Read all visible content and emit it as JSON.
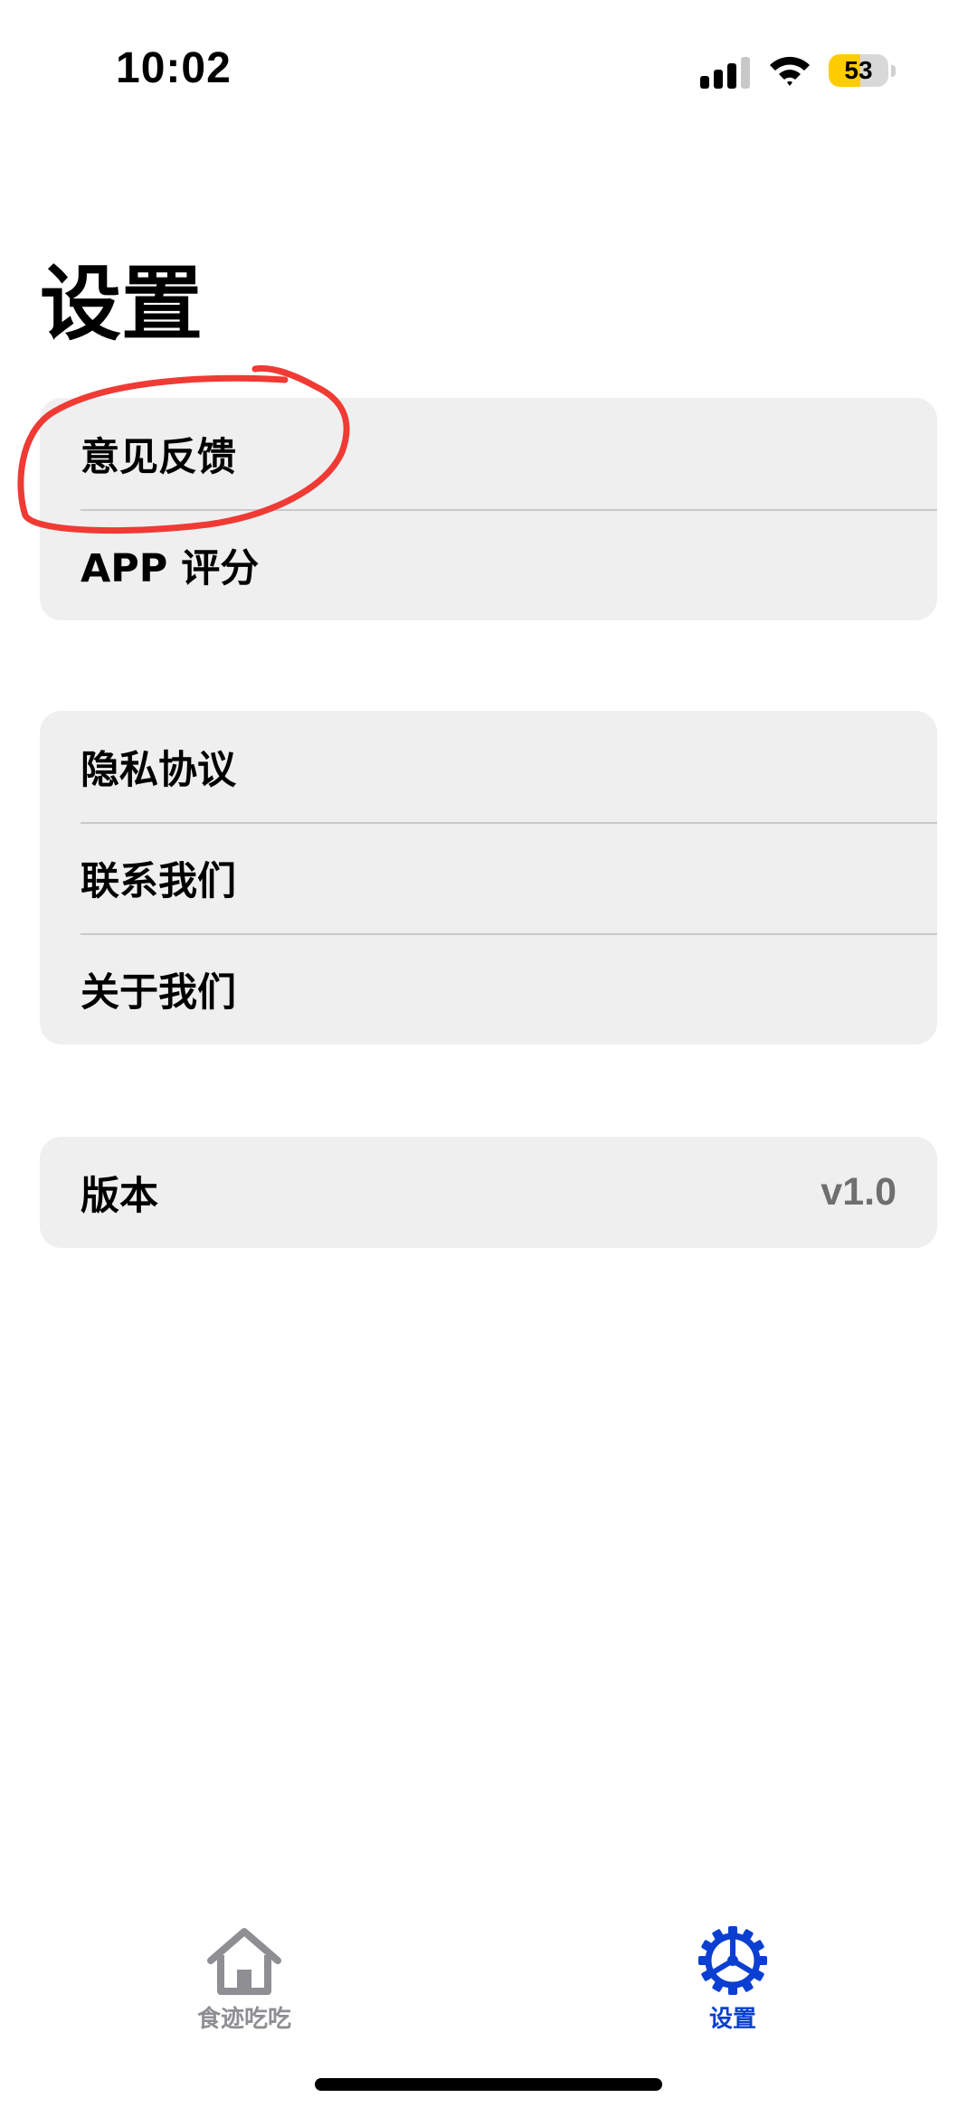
{
  "status_bar": {
    "time": "10:02",
    "battery_level": "53",
    "battery_percent": 53,
    "icons": [
      "signal-icon",
      "wifi-icon",
      "battery-icon"
    ]
  },
  "page": {
    "title": "设置"
  },
  "groups": [
    {
      "rows": [
        {
          "label": "意见反馈"
        },
        {
          "label": "APP 评分"
        }
      ]
    },
    {
      "rows": [
        {
          "label": "隐私协议"
        },
        {
          "label": "联系我们"
        },
        {
          "label": "关于我们"
        }
      ]
    },
    {
      "rows": [
        {
          "label": "版本",
          "value": "v1.0"
        }
      ]
    }
  ],
  "tab_bar": {
    "tabs": [
      {
        "label": "食迹吃吃",
        "icon": "house-icon",
        "active": false
      },
      {
        "label": "设置",
        "icon": "gear-icon",
        "active": true
      }
    ]
  },
  "colors": {
    "accent": "#0a3fd1",
    "inactive_tab": "#8e8e93",
    "group_background": "#efefef",
    "separator": "#c9c9c9",
    "secondary_text": "#6f6f6f",
    "annotation": "#f03a34",
    "battery_fill": "#ffcc00"
  }
}
